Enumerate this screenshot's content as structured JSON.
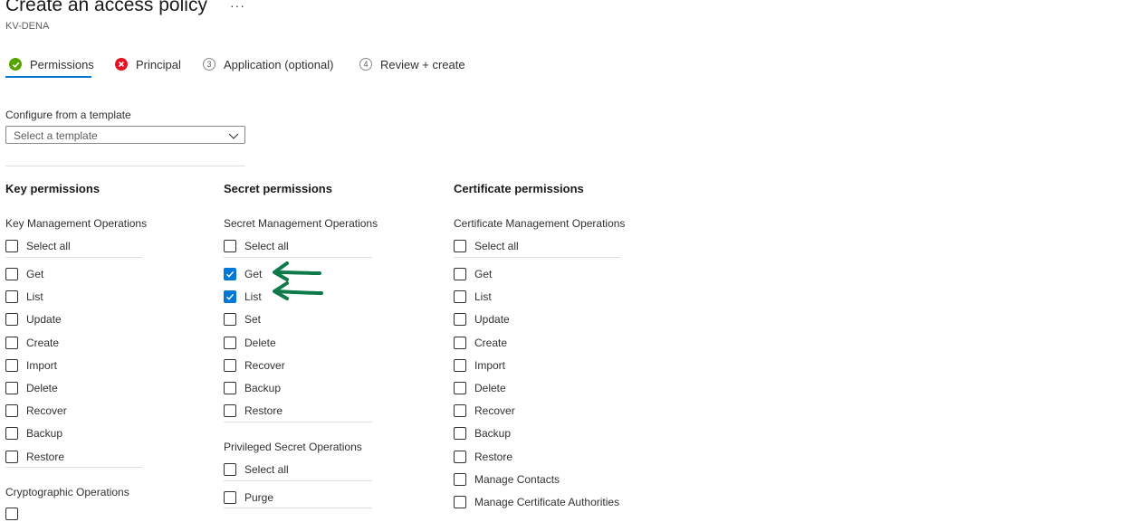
{
  "header": {
    "title": "Create an access policy",
    "subtitle": "KV-DENA",
    "more": "···"
  },
  "tabs": [
    {
      "label": "Permissions",
      "status": "complete",
      "icon": "check-circle-icon",
      "active": true
    },
    {
      "label": "Principal",
      "status": "error",
      "icon": "error-circle-icon",
      "active": false
    },
    {
      "label": "Application (optional)",
      "status": "step",
      "number": "3",
      "active": false
    },
    {
      "label": "Review + create",
      "status": "step",
      "number": "4",
      "active": false
    }
  ],
  "template": {
    "label": "Configure from a template",
    "placeholder": "Select a template"
  },
  "key_permissions": {
    "heading": "Key permissions",
    "management": {
      "label": "Key Management Operations",
      "select_all": "Select all",
      "items": [
        "Get",
        "List",
        "Update",
        "Create",
        "Import",
        "Delete",
        "Recover",
        "Backup",
        "Restore"
      ]
    },
    "cryptographic": {
      "label": "Cryptographic Operations"
    }
  },
  "secret_permissions": {
    "heading": "Secret permissions",
    "management": {
      "label": "Secret Management Operations",
      "select_all": "Select all",
      "items": [
        {
          "label": "Get",
          "checked": true
        },
        {
          "label": "List",
          "checked": true
        },
        {
          "label": "Set",
          "checked": false
        },
        {
          "label": "Delete",
          "checked": false
        },
        {
          "label": "Recover",
          "checked": false
        },
        {
          "label": "Backup",
          "checked": false
        },
        {
          "label": "Restore",
          "checked": false
        }
      ]
    },
    "privileged": {
      "label": "Privileged Secret Operations",
      "select_all": "Select all",
      "items": [
        "Purge"
      ]
    }
  },
  "certificate_permissions": {
    "heading": "Certificate permissions",
    "management": {
      "label": "Certificate Management Operations",
      "select_all": "Select all",
      "items": [
        "Get",
        "List",
        "Update",
        "Create",
        "Import",
        "Delete",
        "Recover",
        "Backup",
        "Restore",
        "Manage Contacts",
        "Manage Certificate Authorities"
      ]
    }
  },
  "annotations": {
    "arrow_color": "#0e7a4a",
    "arrows_point_to": [
      "Get",
      "List"
    ]
  },
  "colors": {
    "accent": "#0078d4",
    "success": "#57a300",
    "error": "#e81123"
  }
}
